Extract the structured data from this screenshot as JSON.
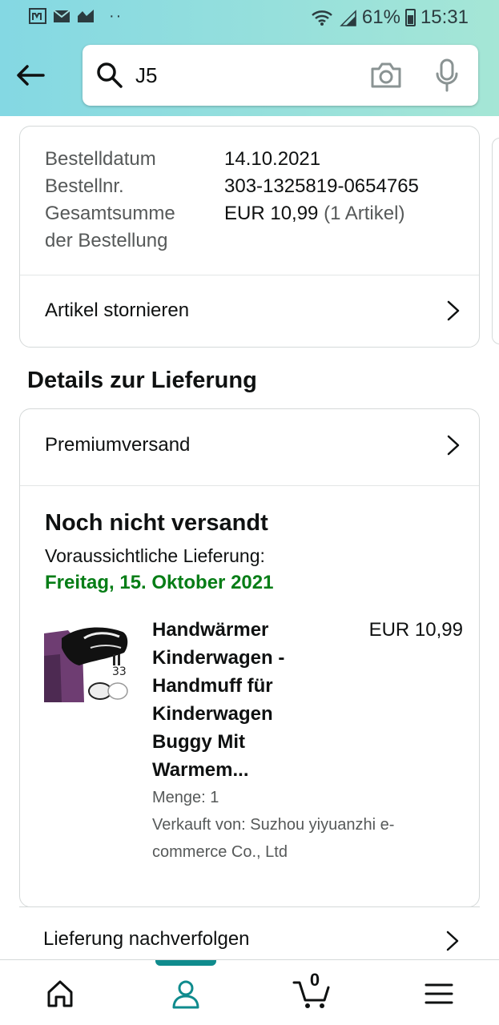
{
  "status_bar": {
    "battery": "61%",
    "time": "15:31"
  },
  "search": {
    "query": "J5"
  },
  "order": {
    "rows": [
      {
        "label": "Bestelldatum",
        "value": "14.10.2021"
      },
      {
        "label": "Bestellnr.",
        "value": "303-1325819-0654765"
      },
      {
        "label": "Gesamtsumme",
        "label2": "der Bestellung",
        "value": "EUR 10,99",
        "value_extra": "(1 Artikel)"
      }
    ],
    "cancel_label": "Artikel stornieren"
  },
  "delivery": {
    "section_title": "Details zur Lieferung",
    "shipping_method": "Premiumversand",
    "status": "Noch nicht versandt",
    "eta_label": "Voraussichtliche Lieferung:",
    "eta_date": "Freitag, 15. Oktober 2021",
    "eta_color": "#067d16",
    "product": {
      "title": "Handwärmer Kinderwagen - Handmuff für Kinderwagen Buggy Mit Warmem...",
      "price": "EUR 10,99",
      "quantity": "Menge: 1",
      "seller": "Verkauft von: Suzhou yiyuanzhi e-commerce Co., Ltd"
    },
    "track_label": "Lieferung nachverfolgen"
  },
  "bottom_nav": {
    "items": [
      "home-icon",
      "account-icon",
      "cart-icon",
      "menu-icon"
    ],
    "active": "account-icon",
    "cart_count": "0",
    "accent": "#0f8b8d"
  },
  "colors": {
    "header_start": "#84d8e3",
    "header_end": "#a5e6d6"
  }
}
